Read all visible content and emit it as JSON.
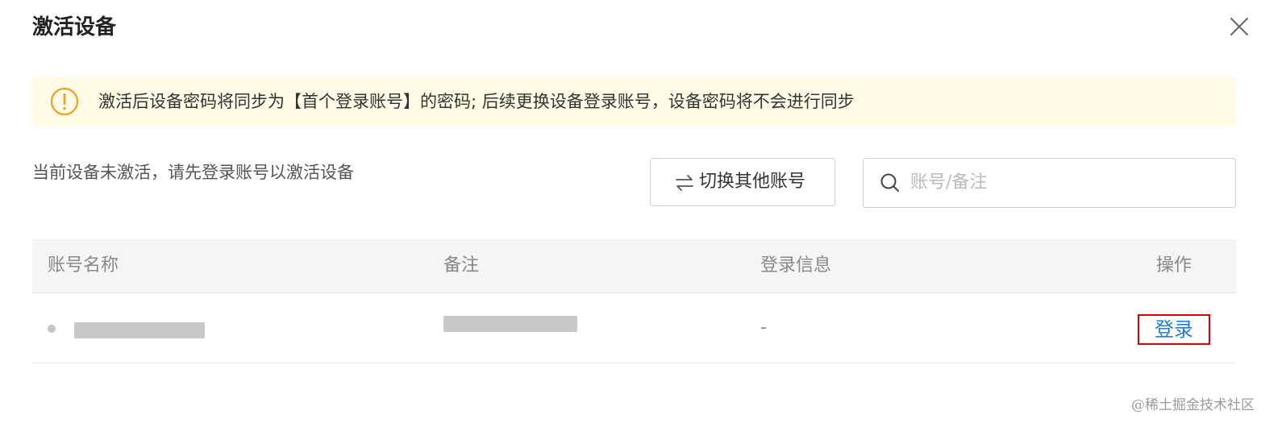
{
  "dialog": {
    "title": "激活设备",
    "close_icon": "close-icon"
  },
  "alert": {
    "icon": "warning-circle-icon",
    "color": "#f0a020",
    "background": "#fffbe6",
    "text": "激活后设备密码将同步为【首个登录账号】的密码; 后续更换设备登录账号，设备密码将不会进行同步"
  },
  "hint": {
    "text": "当前设备未激活，请先登录账号以激活设备"
  },
  "toolbar": {
    "switch_icon": "swap-arrows-icon",
    "switch_label": "切换其他账号",
    "search_icon": "search-icon",
    "search_value": "",
    "search_placeholder": "账号/备注"
  },
  "table": {
    "columns": [
      "账号名称",
      "备注",
      "登录信息",
      "操作"
    ],
    "rows": [
      {
        "account_name": "[redacted]",
        "remark": "[redacted]",
        "login_info": "-",
        "action": "登录"
      }
    ]
  },
  "colors": {
    "link": "#1f7fd6",
    "highlight_border": "#e00000",
    "header_bg": "#f5f5f5"
  },
  "watermark": {
    "text": "@稀土掘金技术社区"
  }
}
